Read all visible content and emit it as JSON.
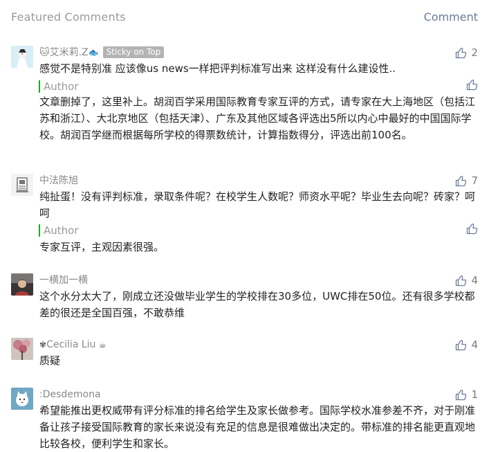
{
  "header": {
    "title": "Featured Comments",
    "write_comment": "Comment"
  },
  "colors": {
    "accent_green": "#1aad19",
    "sticky_badge": "#b4b4b4",
    "icon_blue": "#6b7a99"
  },
  "comments": [
    {
      "nickname": "🐱艾米莉.Z",
      "nickname_suffix": "🐟",
      "sticky_label": "Sticky on Top",
      "likes": "2",
      "text": "感觉不是特别准 应该像us news一样把评判标准写出来 这样没有什么建设性..",
      "reply_label": "Author",
      "reply_text": "文章删掉了，这里补上。胡润百学采用国际教育专家互评的方式，请专家在大上海地区（包括江苏和浙江）、大北京地区（包括天津）、广东及其他区域各评选出5所以内心中最好的中国国际学校。胡润百学继而根据每所学校的得票数统计，计算指数得分，评选出前100名。"
    },
    {
      "nickname": "中法陈旭",
      "likes": "7",
      "text": "纯扯蛋！没有评判标准，录取条件呢？在校学生人数呢？师资水平呢？毕业生去向呢？砖家？呵呵",
      "reply_label": "Author",
      "reply_text": "专家互评，主观因素很强。"
    },
    {
      "nickname": "一横加一横",
      "likes": "4",
      "text": "这个水分太大了，刚成立还没做毕业学生的学校排在30多位，UWC排在50位。还有很多学校都差的很还是全国百强，不敢恭维"
    },
    {
      "nickname": "Cecilia Liu",
      "nickname_prefix": "✾",
      "nickname_suffix": "☕",
      "likes": "4",
      "text": "质疑"
    },
    {
      "nickname": ":Desdemona",
      "likes": "1",
      "text": "希望能推出更权威带有评分标准的排名给学生及家长做参考。国际学校水准参差不齐，对于刚准备让孩子接受国际教育的家长来说没有充足的信息是很难做出决定的。带标准的排名能更直观地比较各校，便利学生和家长。"
    }
  ]
}
